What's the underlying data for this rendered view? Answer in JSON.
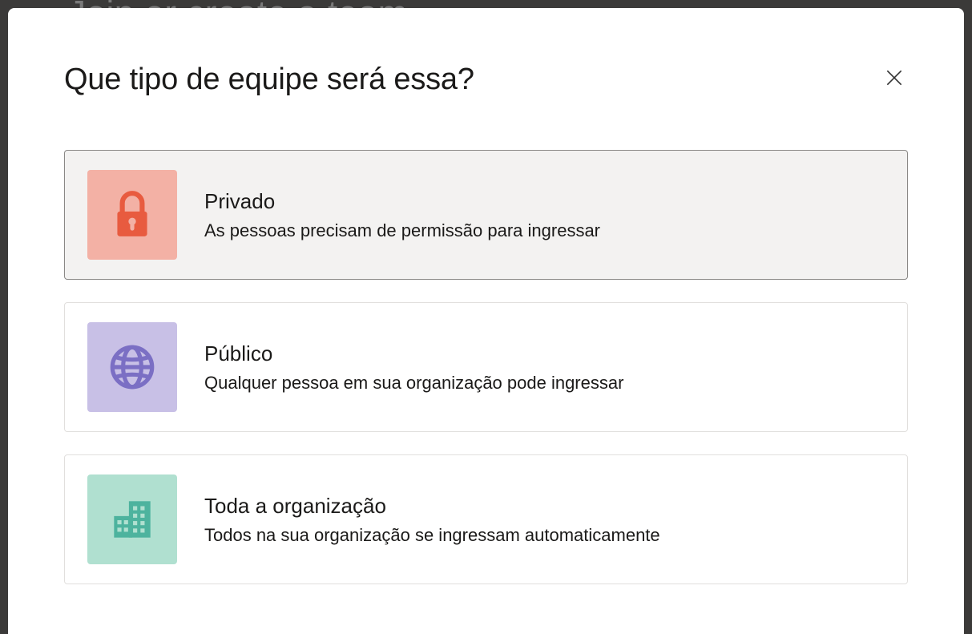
{
  "backdrop": {
    "heading": "Join or create a team"
  },
  "modal": {
    "title": "Que tipo de equipe será essa?",
    "options": [
      {
        "title": "Privado",
        "desc": "As pessoas precisam de permissão para ingressar"
      },
      {
        "title": "Público",
        "desc": "Qualquer pessoa em sua organização pode ingressar"
      },
      {
        "title": "Toda a organização",
        "desc": "Todos na sua organização se ingressam automaticamente"
      }
    ]
  }
}
